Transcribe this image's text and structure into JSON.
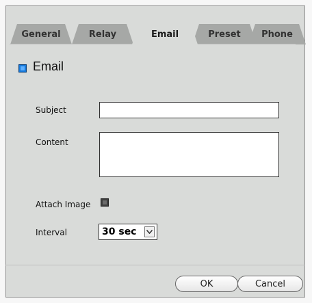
{
  "tabs": [
    {
      "label": "General",
      "active": false
    },
    {
      "label": "Relay",
      "active": false
    },
    {
      "label": "Email",
      "active": true
    },
    {
      "label": "Preset",
      "active": false
    },
    {
      "label": "Phone",
      "active": false
    }
  ],
  "email": {
    "title": "Email",
    "enabled": true,
    "subject_label": "Subject",
    "subject_value": "",
    "content_label": "Content",
    "content_value": "",
    "attach_label": "Attach Image",
    "attach_checked": false,
    "interval_label": "Interval",
    "interval_value": "30 sec"
  },
  "buttons": {
    "ok": "OK",
    "cancel": "Cancel"
  },
  "colors": {
    "checkbox_on": "#1577d8",
    "tab_active": "#d9dbd9",
    "tab_inactive": "#a6a8a6"
  }
}
